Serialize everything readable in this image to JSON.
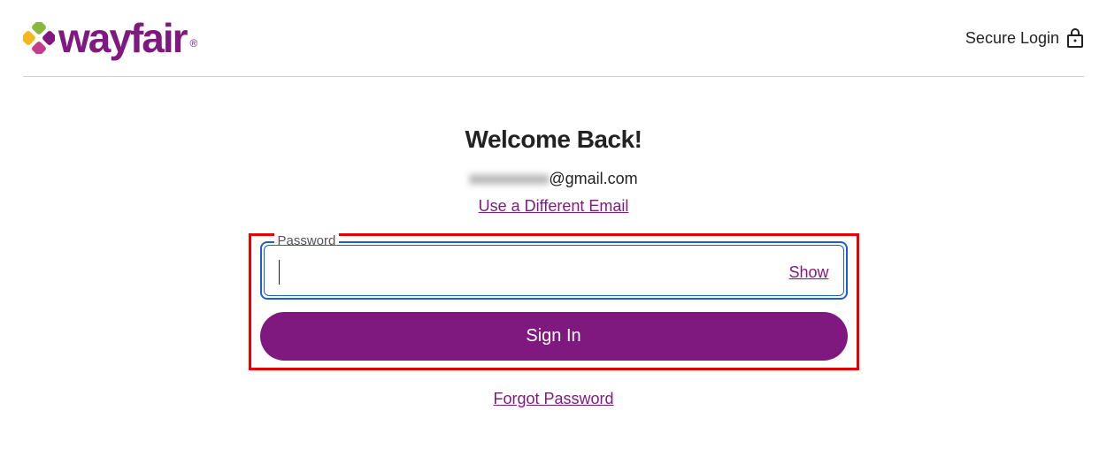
{
  "header": {
    "brand": "wayfair",
    "secure_label": "Secure Login"
  },
  "main": {
    "heading": "Welcome Back!",
    "email_hidden": "xxxxxxxxxx",
    "email_domain": "@gmail.com",
    "different_email_link": "Use a Different Email",
    "password_label": "Password",
    "show_label": "Show",
    "signin_label": "Sign In",
    "forgot_label": "Forgot Password"
  },
  "colors": {
    "brand_purple": "#7f187f",
    "highlight_red": "#e60000",
    "focus_blue": "#1a5fd6"
  }
}
